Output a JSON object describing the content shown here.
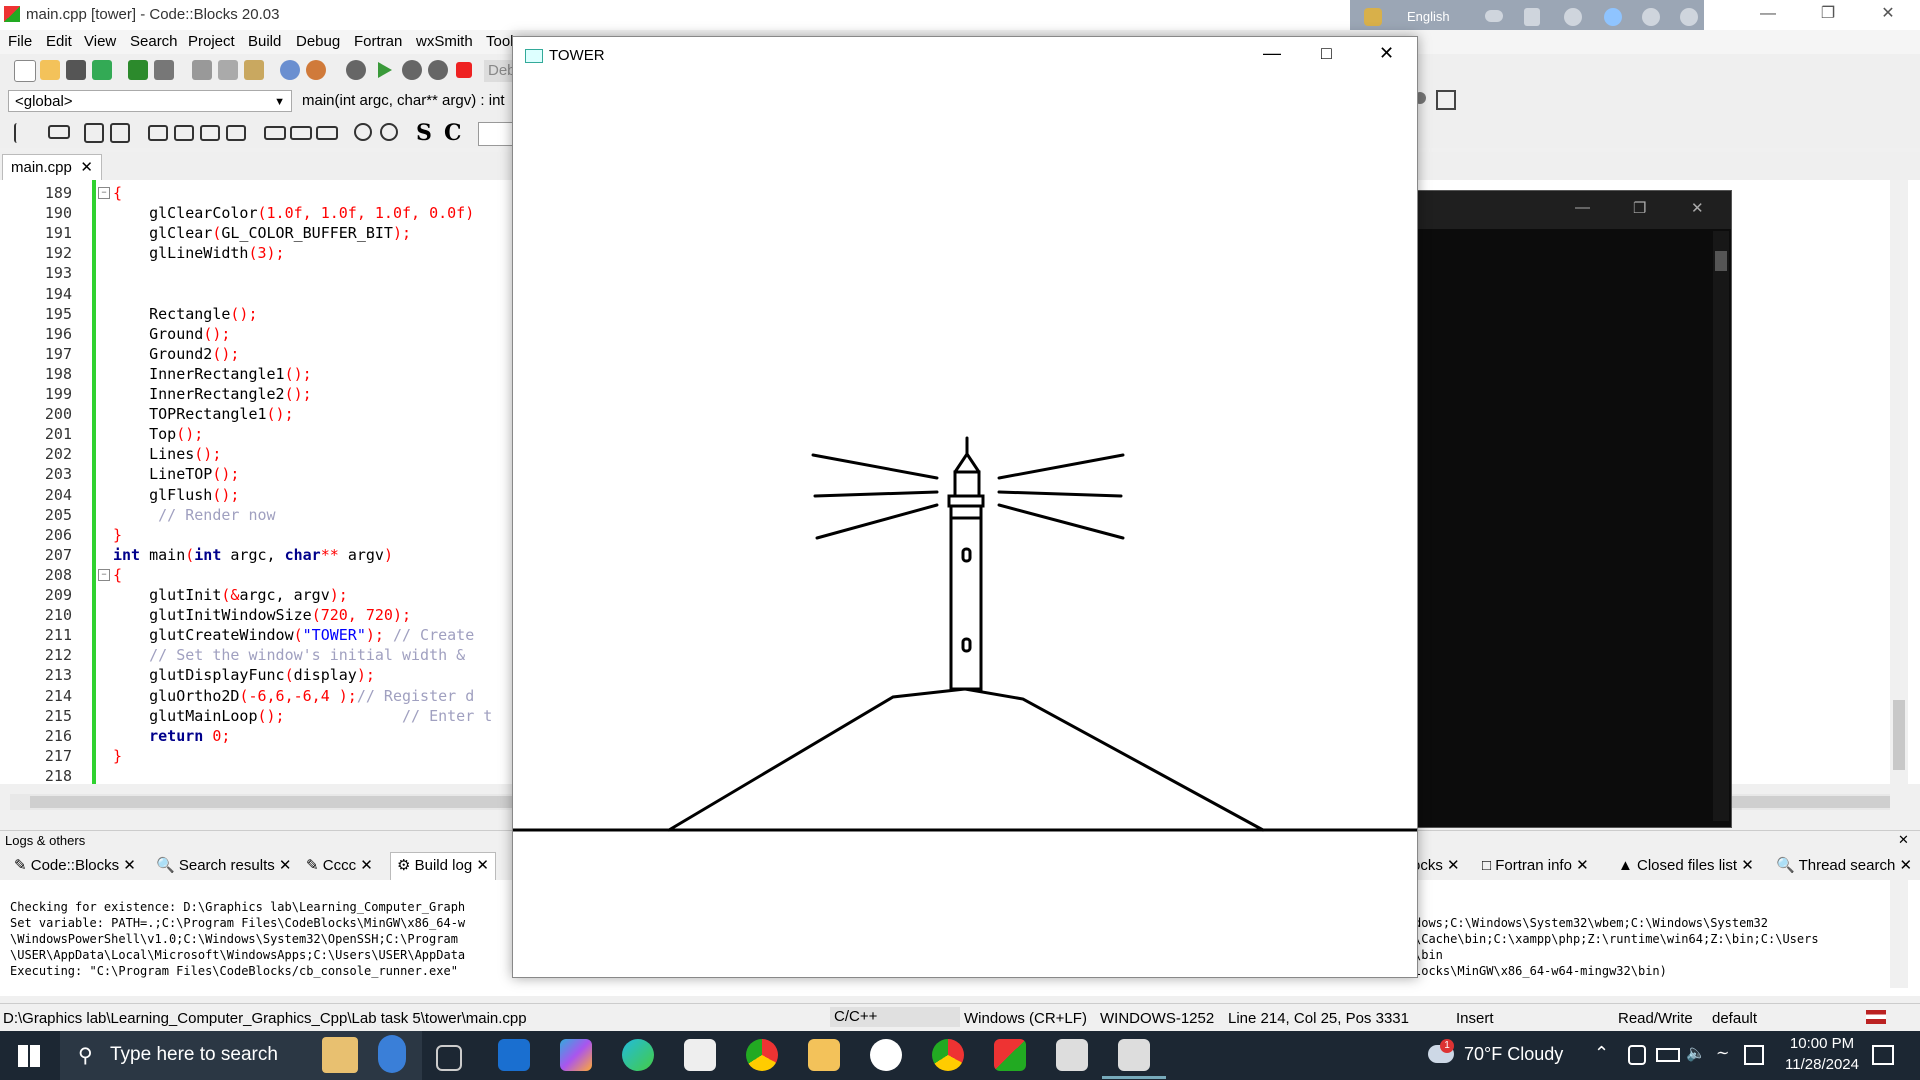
{
  "window": {
    "title": "main.cpp [tower] - Code::Blocks 20.03"
  },
  "menu": [
    "File",
    "Edit",
    "View",
    "Search",
    "Project",
    "Build",
    "Debug",
    "Fortran",
    "wxSmith",
    "Tools"
  ],
  "toolbar": {
    "debug_label": "Deb",
    "scope_combo": "<global>",
    "function_combo": "main(int argc, char** argv) : int"
  },
  "editor": {
    "tab_label": "main.cpp",
    "lines": [
      {
        "n": "189",
        "tokens": [
          {
            "t": "{",
            "c": "pun"
          }
        ],
        "fold": true
      },
      {
        "n": "190",
        "tokens": [
          {
            "t": "    glClearColor",
            "c": "fn"
          },
          {
            "t": "(",
            "c": "pun"
          },
          {
            "t": "1.0f, 1.0f, 1.0f, 0.0f",
            "c": "num"
          },
          {
            "t": ")",
            "c": "pun"
          }
        ]
      },
      {
        "n": "191",
        "tokens": [
          {
            "t": "    glClear",
            "c": "fn"
          },
          {
            "t": "(",
            "c": "pun"
          },
          {
            "t": "GL_COLOR_BUFFER_BIT",
            "c": "fn"
          },
          {
            "t": ");",
            "c": "pun"
          }
        ]
      },
      {
        "n": "192",
        "tokens": [
          {
            "t": "    glLineWidth",
            "c": "fn"
          },
          {
            "t": "(",
            "c": "pun"
          },
          {
            "t": "3",
            "c": "num"
          },
          {
            "t": ");",
            "c": "pun"
          }
        ]
      },
      {
        "n": "193",
        "tokens": []
      },
      {
        "n": "194",
        "tokens": []
      },
      {
        "n": "195",
        "tokens": [
          {
            "t": "    Rectangle",
            "c": "fn"
          },
          {
            "t": "();",
            "c": "pun"
          }
        ]
      },
      {
        "n": "196",
        "tokens": [
          {
            "t": "    Ground",
            "c": "fn"
          },
          {
            "t": "();",
            "c": "pun"
          }
        ]
      },
      {
        "n": "197",
        "tokens": [
          {
            "t": "    Ground2",
            "c": "fn"
          },
          {
            "t": "();",
            "c": "pun"
          }
        ]
      },
      {
        "n": "198",
        "tokens": [
          {
            "t": "    InnerRectangle1",
            "c": "fn"
          },
          {
            "t": "();",
            "c": "pun"
          }
        ]
      },
      {
        "n": "199",
        "tokens": [
          {
            "t": "    InnerRectangle2",
            "c": "fn"
          },
          {
            "t": "();",
            "c": "pun"
          }
        ]
      },
      {
        "n": "200",
        "tokens": [
          {
            "t": "    TOPRectangle1",
            "c": "fn"
          },
          {
            "t": "();",
            "c": "pun"
          }
        ]
      },
      {
        "n": "201",
        "tokens": [
          {
            "t": "    Top",
            "c": "fn"
          },
          {
            "t": "();",
            "c": "pun"
          }
        ]
      },
      {
        "n": "202",
        "tokens": [
          {
            "t": "    Lines",
            "c": "fn"
          },
          {
            "t": "();",
            "c": "pun"
          }
        ]
      },
      {
        "n": "203",
        "tokens": [
          {
            "t": "    LineTOP",
            "c": "fn"
          },
          {
            "t": "();",
            "c": "pun"
          }
        ]
      },
      {
        "n": "204",
        "tokens": [
          {
            "t": "    glFlush",
            "c": "fn"
          },
          {
            "t": "();",
            "c": "pun"
          }
        ]
      },
      {
        "n": "205",
        "tokens": [
          {
            "t": "     // Render now",
            "c": "cm"
          }
        ]
      },
      {
        "n": "206",
        "tokens": [
          {
            "t": "}",
            "c": "pun"
          }
        ]
      },
      {
        "n": "207",
        "tokens": [
          {
            "t": "int",
            "c": "kw"
          },
          {
            "t": " main",
            "c": "fn"
          },
          {
            "t": "(",
            "c": "pun"
          },
          {
            "t": "int",
            "c": "kw"
          },
          {
            "t": " argc, ",
            "c": "fn"
          },
          {
            "t": "char",
            "c": "kw"
          },
          {
            "t": "** ",
            "c": "pun"
          },
          {
            "t": "argv",
            "c": "fn"
          },
          {
            "t": ")",
            "c": "pun"
          }
        ]
      },
      {
        "n": "208",
        "tokens": [
          {
            "t": "{",
            "c": "pun"
          }
        ],
        "fold": true
      },
      {
        "n": "209",
        "tokens": [
          {
            "t": "    glutInit",
            "c": "fn"
          },
          {
            "t": "(&",
            "c": "pun"
          },
          {
            "t": "argc, argv",
            "c": "fn"
          },
          {
            "t": ");",
            "c": "pun"
          }
        ]
      },
      {
        "n": "210",
        "tokens": [
          {
            "t": "    glutInitWindowSize",
            "c": "fn"
          },
          {
            "t": "(",
            "c": "pun"
          },
          {
            "t": "720, 720",
            "c": "num"
          },
          {
            "t": ");",
            "c": "pun"
          }
        ]
      },
      {
        "n": "211",
        "tokens": [
          {
            "t": "    glutCreateWindow",
            "c": "fn"
          },
          {
            "t": "(",
            "c": "pun"
          },
          {
            "t": "\"TOWER\"",
            "c": "str"
          },
          {
            "t": "); ",
            "c": "pun"
          },
          {
            "t": "// Create",
            "c": "cm"
          }
        ]
      },
      {
        "n": "212",
        "tokens": [
          {
            "t": "    // Set the window's initial width &",
            "c": "cm"
          }
        ]
      },
      {
        "n": "213",
        "tokens": [
          {
            "t": "    glutDisplayFunc",
            "c": "fn"
          },
          {
            "t": "(",
            "c": "pun"
          },
          {
            "t": "display",
            "c": "fn"
          },
          {
            "t": ");",
            "c": "pun"
          }
        ]
      },
      {
        "n": "214",
        "tokens": [
          {
            "t": "    gluOrtho2D",
            "c": "fn"
          },
          {
            "t": "(",
            "c": "pun"
          },
          {
            "t": "-6,6,-6,4 ",
            "c": "num"
          },
          {
            "t": ");",
            "c": "pun"
          },
          {
            "t": "// Register d",
            "c": "cm"
          }
        ]
      },
      {
        "n": "215",
        "tokens": [
          {
            "t": "    glutMainLoop",
            "c": "fn"
          },
          {
            "t": "();",
            "c": "pun"
          },
          {
            "t": "             // Enter t",
            "c": "cm"
          }
        ]
      },
      {
        "n": "216",
        "tokens": [
          {
            "t": "    ",
            "c": "fn"
          },
          {
            "t": "return",
            "c": "kw"
          },
          {
            "t": " ",
            "c": "fn"
          },
          {
            "t": "0",
            "c": "num"
          },
          {
            "t": ";",
            "c": "pun"
          }
        ]
      },
      {
        "n": "217",
        "tokens": [
          {
            "t": "}",
            "c": "pun"
          }
        ]
      },
      {
        "n": "218",
        "tokens": []
      }
    ]
  },
  "tower_window": {
    "title": "TOWER"
  },
  "logs": {
    "header": "Logs & others",
    "tabs": [
      "Code::Blocks",
      "Search results",
      "Cccc",
      "Build log",
      "ocks",
      "Fortran info",
      "Closed files list",
      "Thread search"
    ],
    "lines_left": [
      "Checking for existence: D:\\Graphics lab\\Learning_Computer_Graph",
      "Set variable: PATH=.;C:\\Program Files\\CodeBlocks\\MinGW\\x86_64-w",
      "\\WindowsPowerShell\\v1.0;C:\\Windows\\System32\\OpenSSH;C:\\Program",
      "\\USER\\AppData\\Local\\Microsoft\\WindowsApps;C:\\Users\\USER\\AppData",
      "Executing: \"C:\\Program Files\\CodeBlocks/cb_console_runner.exe\""
    ],
    "lines_right": [
      "dows;C:\\Windows\\System32\\wbem;C:\\Windows\\System32",
      "\\Cache\\bin;C:\\xampp\\php;Z:\\runtime\\win64;Z:\\bin;C:\\Users",
      "\\bin",
      "locks\\MinGW\\x86_64-w64-mingw32\\bin)"
    ]
  },
  "status": {
    "path": "D:\\Graphics lab\\Learning_Computer_Graphics_Cpp\\Lab task 5\\tower\\main.cpp",
    "lang": "C/C++",
    "eol": "Windows (CR+LF)",
    "encoding": "WINDOWS-1252",
    "position": "Line 214, Col 25, Pos 3331",
    "mode": "Insert",
    "access": "Read/Write",
    "profile": "default"
  },
  "langbar": {
    "language": "English"
  },
  "taskbar": {
    "search_placeholder": "Type here to search",
    "weather": "70°F  Cloudy",
    "time": "10:00 PM",
    "date": "11/28/2024",
    "notification_badge": "1"
  }
}
